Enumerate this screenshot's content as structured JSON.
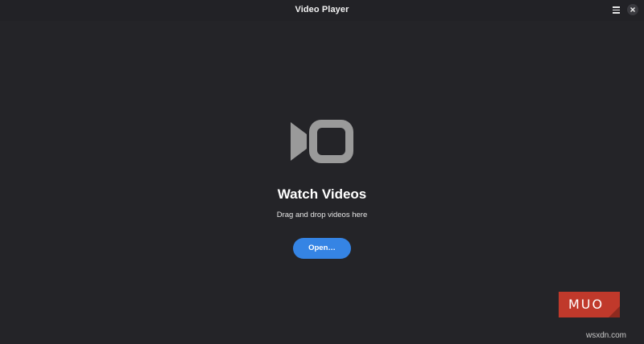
{
  "window": {
    "title": "Video Player"
  },
  "header": {
    "menu_icon": "hamburger-menu-icon",
    "close_icon": "close-icon"
  },
  "empty_state": {
    "icon": "video-camera-icon",
    "heading": "Watch Videos",
    "subtext": "Drag and drop videos here",
    "open_button_label": "Open…"
  },
  "overlay": {
    "logo_text": "MUO",
    "watermark": "wsxdn.com"
  },
  "colors": {
    "background": "#242428",
    "accent": "#3584e4",
    "icon_gray": "#9a9a9a",
    "logo_red": "#c0392b"
  }
}
